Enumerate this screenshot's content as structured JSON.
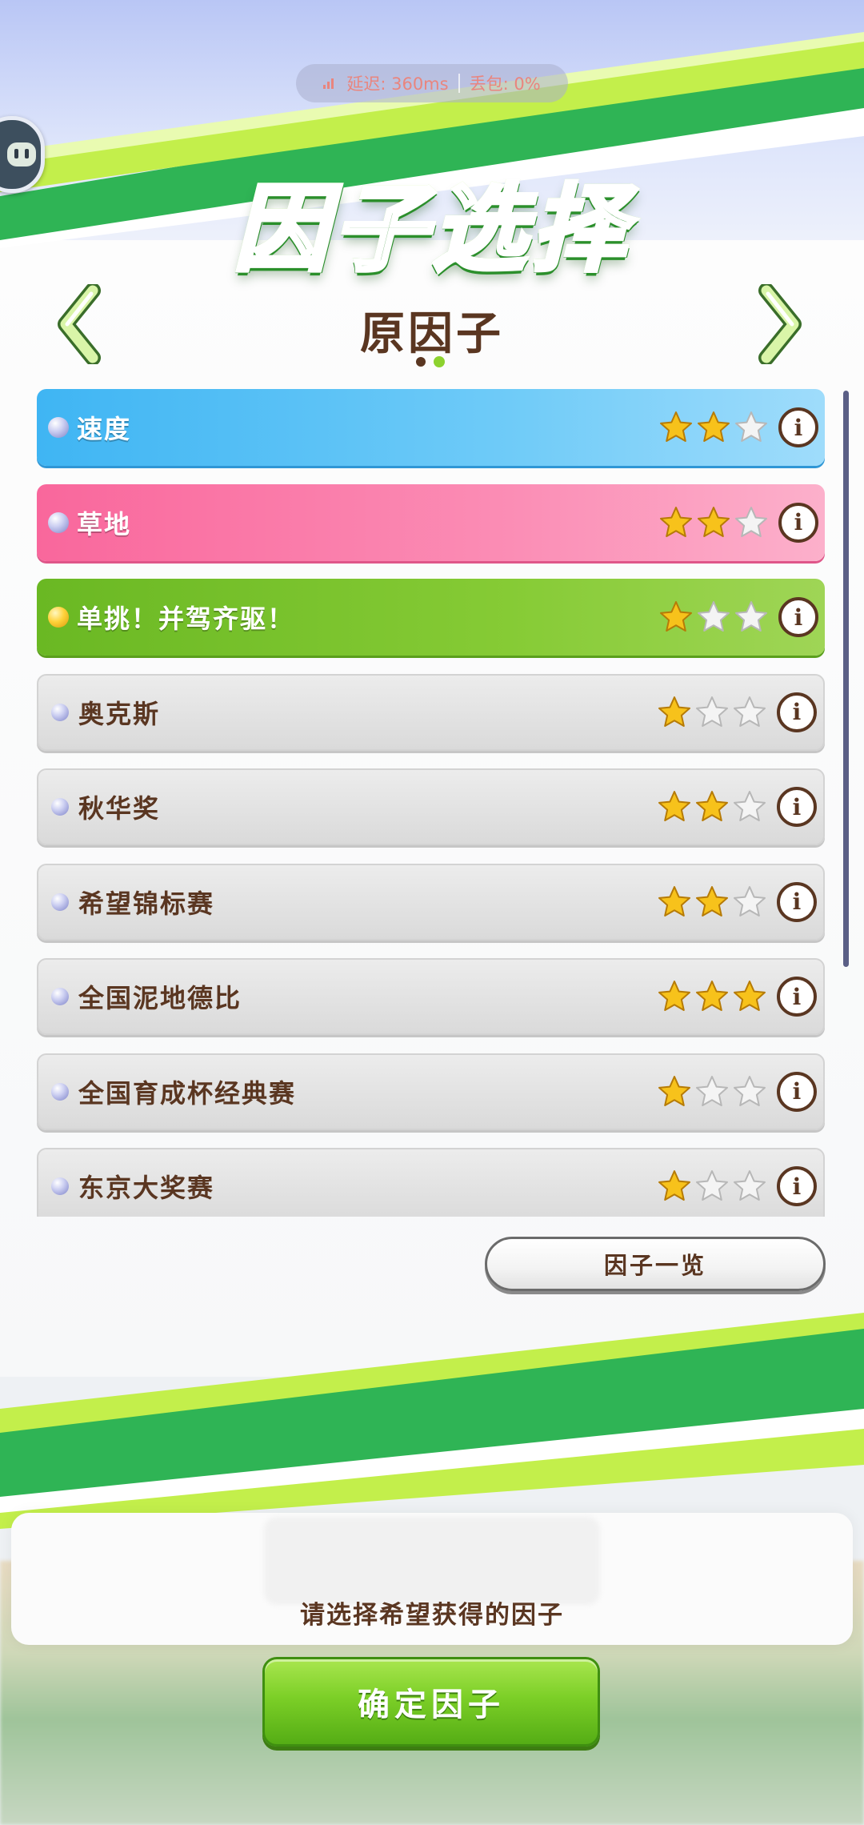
{
  "status": {
    "latency": "延迟: 360ms",
    "packet_loss": "丢包: 0%"
  },
  "header": {
    "title": "因子选择",
    "category": "原因子",
    "page_count": 2,
    "active_page": 2
  },
  "factors": [
    {
      "name": "速度",
      "style": "blue",
      "dot": "silver",
      "stars": 2,
      "stars_max": 3
    },
    {
      "name": "草地",
      "style": "pink",
      "dot": "silver",
      "stars": 2,
      "stars_max": 3
    },
    {
      "name": "单挑！并驾齐驱！",
      "style": "green",
      "dot": "gold",
      "stars": 1,
      "stars_max": 3
    },
    {
      "name": "奥克斯",
      "style": "grey",
      "dot": "silver",
      "stars": 1,
      "stars_max": 3
    },
    {
      "name": "秋华奖",
      "style": "grey",
      "dot": "silver",
      "stars": 2,
      "stars_max": 3
    },
    {
      "name": "希望锦标赛",
      "style": "grey",
      "dot": "silver",
      "stars": 2,
      "stars_max": 3
    },
    {
      "name": "全国泥地德比",
      "style": "grey",
      "dot": "silver",
      "stars": 3,
      "stars_max": 3
    },
    {
      "name": "全国育成杯经典赛",
      "style": "grey",
      "dot": "silver",
      "stars": 1,
      "stars_max": 3
    },
    {
      "name": "东京大奖赛",
      "style": "grey",
      "dot": "silver",
      "stars": 1,
      "stars_max": 3
    }
  ],
  "info_label": "i",
  "buttons": {
    "overview": "因子一览",
    "confirm": "确定因子"
  },
  "hint": "请选择希望获得的因子",
  "colors": {
    "text_brown": "#5a3621",
    "accent_green": "#7ccf27",
    "speed_blue": "#3fb5f3",
    "turf_pink": "#f9679c",
    "skill_green": "#6ab823",
    "star_gold": "#f7c21b"
  },
  "icons": {
    "star_filled": "star-filled-icon",
    "star_empty": "star-empty-icon",
    "info": "info-icon",
    "prev": "chevron-left-icon",
    "next": "chevron-right-icon"
  }
}
